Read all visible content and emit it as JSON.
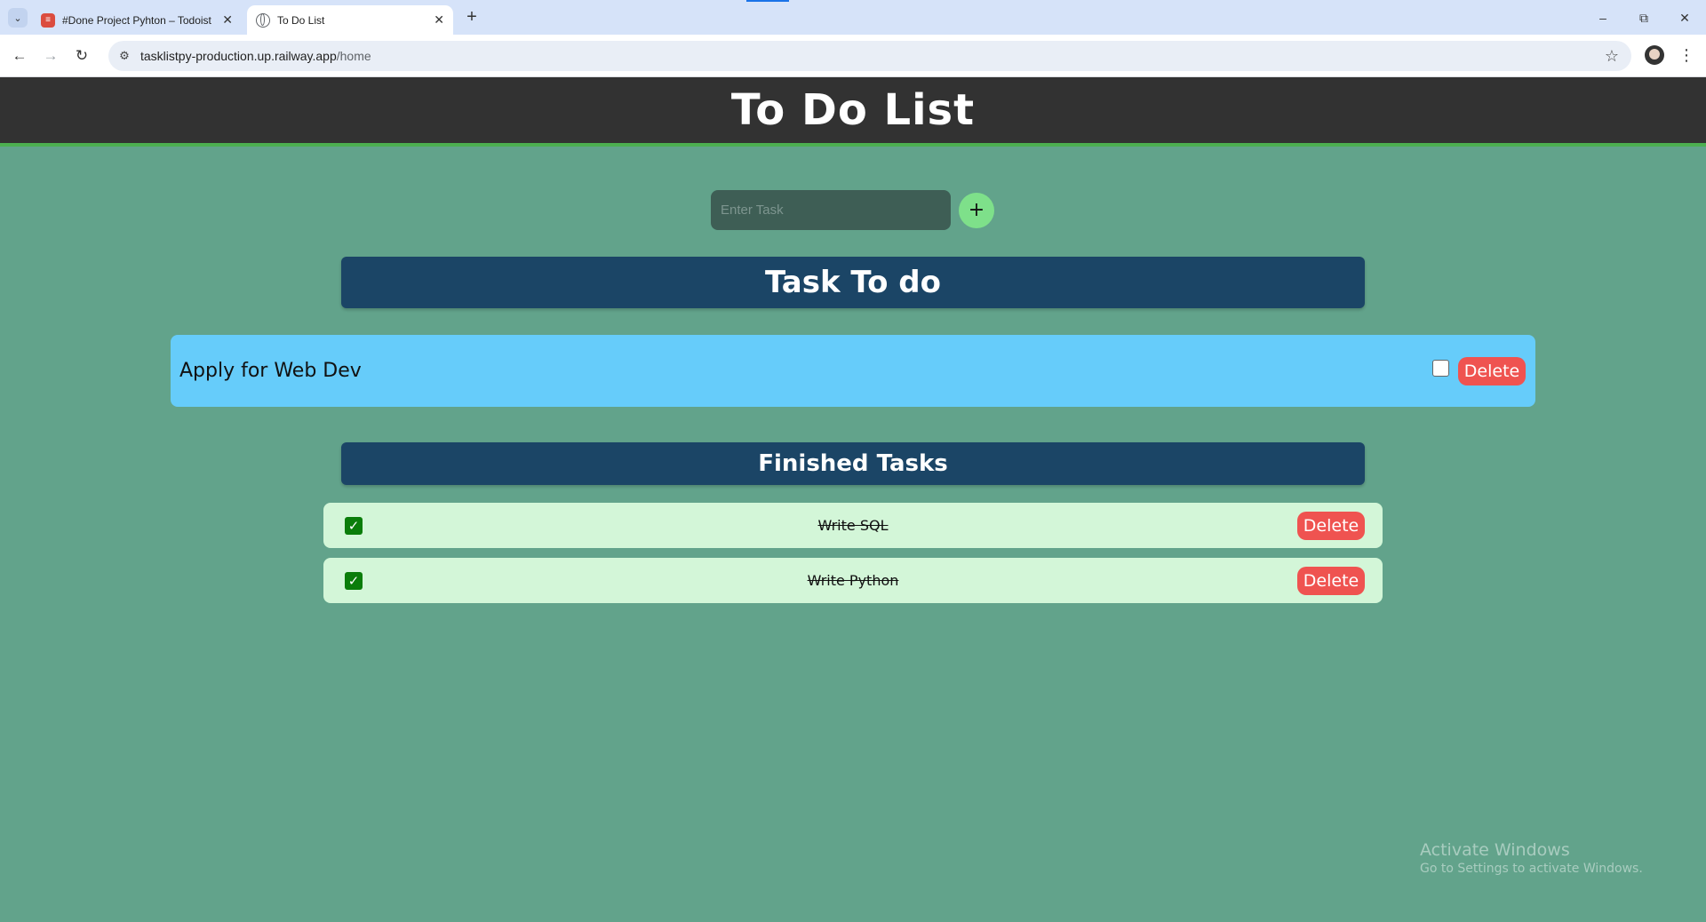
{
  "browser": {
    "tabs": [
      {
        "title": "#Done Project Pyhton – Todoist",
        "active": false,
        "icon": "todoist-icon"
      },
      {
        "title": "To Do List",
        "active": true,
        "icon": "globe-icon"
      }
    ],
    "url_host": "tasklistpy-production.up.railway.app",
    "url_path": "/home"
  },
  "page": {
    "title": "To Do List",
    "input_placeholder": "Enter Task",
    "add_label": "+",
    "todo_section_title": "Task To do",
    "finished_section_title": "Finished Tasks",
    "todo_tasks": [
      {
        "text": "Apply for Web Dev",
        "checked": false,
        "delete_label": "Delete"
      }
    ],
    "finished_tasks": [
      {
        "text": "Write SQL",
        "checked": true,
        "delete_label": "Delete"
      },
      {
        "text": "Write Python",
        "checked": true,
        "delete_label": "Delete"
      }
    ]
  },
  "watermark": {
    "line1": "Activate Windows",
    "line2": "Go to Settings to activate Windows."
  },
  "colors": {
    "page_bg": "#62a38b",
    "header_bg": "#323232",
    "header_border": "#4caf50",
    "section_bg": "#1b4566",
    "todo_item_bg": "#66ccfa",
    "done_item_bg": "#d3f6d8",
    "delete_bg": "#ef5350",
    "add_btn_bg": "#7ee08a"
  }
}
